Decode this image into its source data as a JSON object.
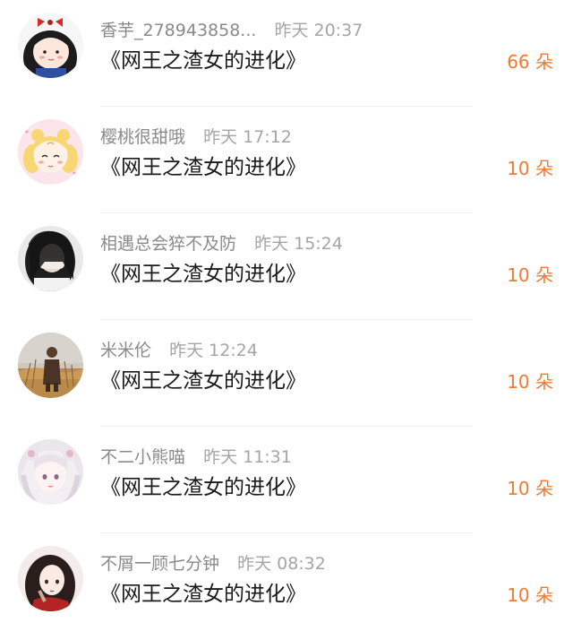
{
  "rows": [
    {
      "name": "香芋_278943858...",
      "time": "昨天 20:37",
      "title": "《网王之渣女的进化》",
      "count": "66 朵"
    },
    {
      "name": "樱桃很甜哦",
      "time": "昨天 17:12",
      "title": "《网王之渣女的进化》",
      "count": "10 朵"
    },
    {
      "name": "相遇总会猝不及防",
      "time": "昨天 15:24",
      "title": "《网王之渣女的进化》",
      "count": "10 朵"
    },
    {
      "name": "米米伦",
      "time": "昨天 12:24",
      "title": "《网王之渣女的进化》",
      "count": "10 朵"
    },
    {
      "name": "不二小熊喵",
      "time": "昨天 11:31",
      "title": "《网王之渣女的进化》",
      "count": "10 朵"
    },
    {
      "name": "不屑一顾七分钟",
      "time": "昨天 08:32",
      "title": "《网王之渣女的进化》",
      "count": "10 朵"
    }
  ],
  "colors": {
    "count": "#ee7a36",
    "name": "#8a8a8a",
    "title": "#1a1a1a"
  }
}
